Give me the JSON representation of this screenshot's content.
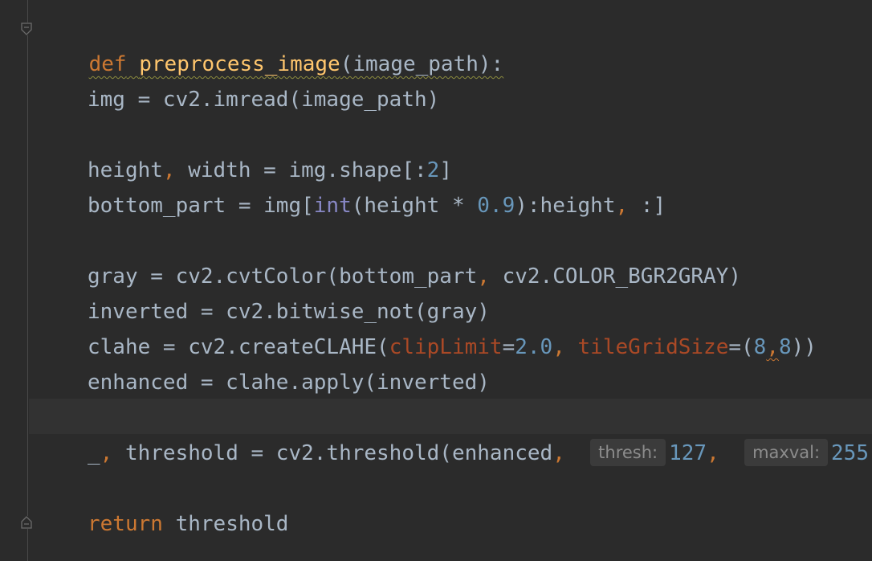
{
  "code": {
    "def_kw": "def",
    "func_name": "preprocess_image",
    "func_sig": "(image_path):",
    "line_imread": {
      "lhs": "img = cv2.imread(image_path)"
    },
    "line_shape": {
      "a": "height",
      "comma": ",",
      "b": " width = img.shape[:",
      "num": "2",
      "end": "]"
    },
    "line_bottom": {
      "a": "bottom_part = img[",
      "builtin": "int",
      "b": "(height * ",
      "num": "0.9",
      "c": "):height",
      "comma": ",",
      "d": " :]"
    },
    "line_gray": {
      "a": "gray = cv2.cvtColor(bottom_part",
      "comma": ",",
      "b": " cv2.COLOR_BGR2GRAY)"
    },
    "line_inverted": {
      "a": "inverted = cv2.bitwise_not(gray)"
    },
    "line_clahe": {
      "a": "clahe = cv2.createCLAHE(",
      "p1": "clipLimit",
      "eq1": "=",
      "n1": "2.0",
      "comma1": ",",
      "p2": "tileGridSize",
      "eq2": "=(",
      "n2": "8",
      "comma2": ",",
      "n3": "8",
      "end": "))"
    },
    "line_enhanced": {
      "a": "enhanced = clahe.apply(inverted)"
    },
    "line_threshold": {
      "a": "_",
      "comma0": ",",
      "b": " threshold = cv2.threshold(enhanced",
      "comma1": ",",
      "hint1": "thresh:",
      "n1": "127",
      "comma2": ",",
      "hint2": "maxval:",
      "n2": "255",
      "comma3": ","
    },
    "line_return": {
      "kw": "return",
      "a": " threshold"
    }
  },
  "colors": {
    "background": "#2b2b2b",
    "keyword": "#cc7832",
    "function": "#ffc66d",
    "number": "#6897bb",
    "parameter": "#aa4926",
    "text": "#a9b7c6",
    "builtin": "#8888c6"
  }
}
